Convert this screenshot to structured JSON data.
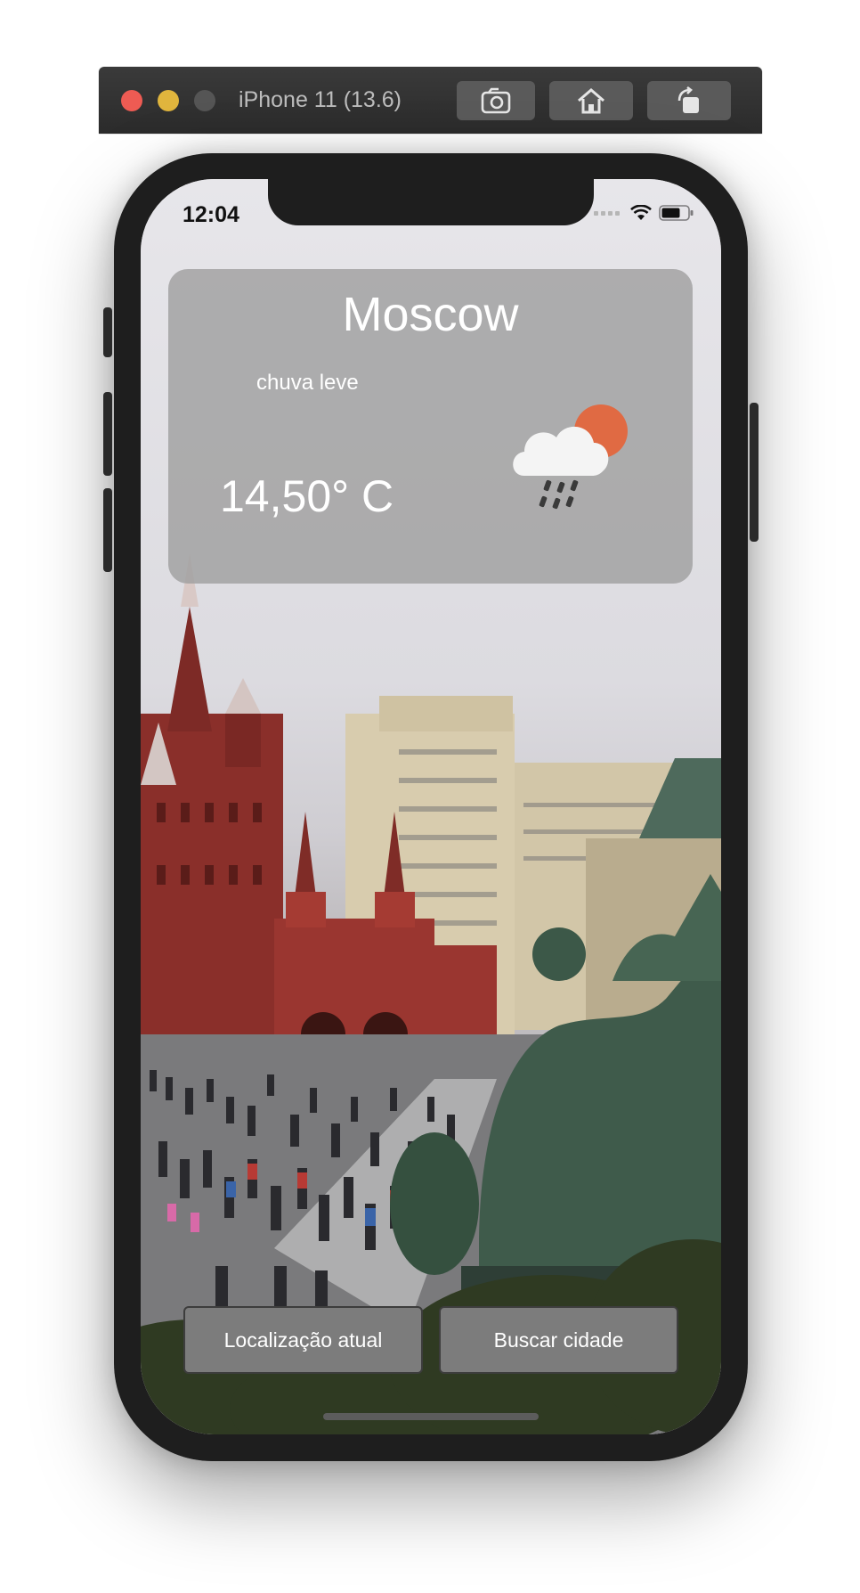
{
  "simulator": {
    "title": "iPhone 11 (13.6)",
    "toolbar_icons": [
      "screenshot-icon",
      "home-icon",
      "rotate-icon"
    ]
  },
  "status_bar": {
    "time": "12:04",
    "icons": [
      "signal-icon",
      "wifi-icon",
      "battery-icon"
    ]
  },
  "weather": {
    "city": "Moscow",
    "description": "chuva leve",
    "temperature": "14,50° C",
    "icon": "rain-cloud-sun-icon"
  },
  "buttons": {
    "current_location": "Localização atual",
    "search_city": "Buscar cidade"
  },
  "background": {
    "image": "red-square-moscow-photo"
  }
}
